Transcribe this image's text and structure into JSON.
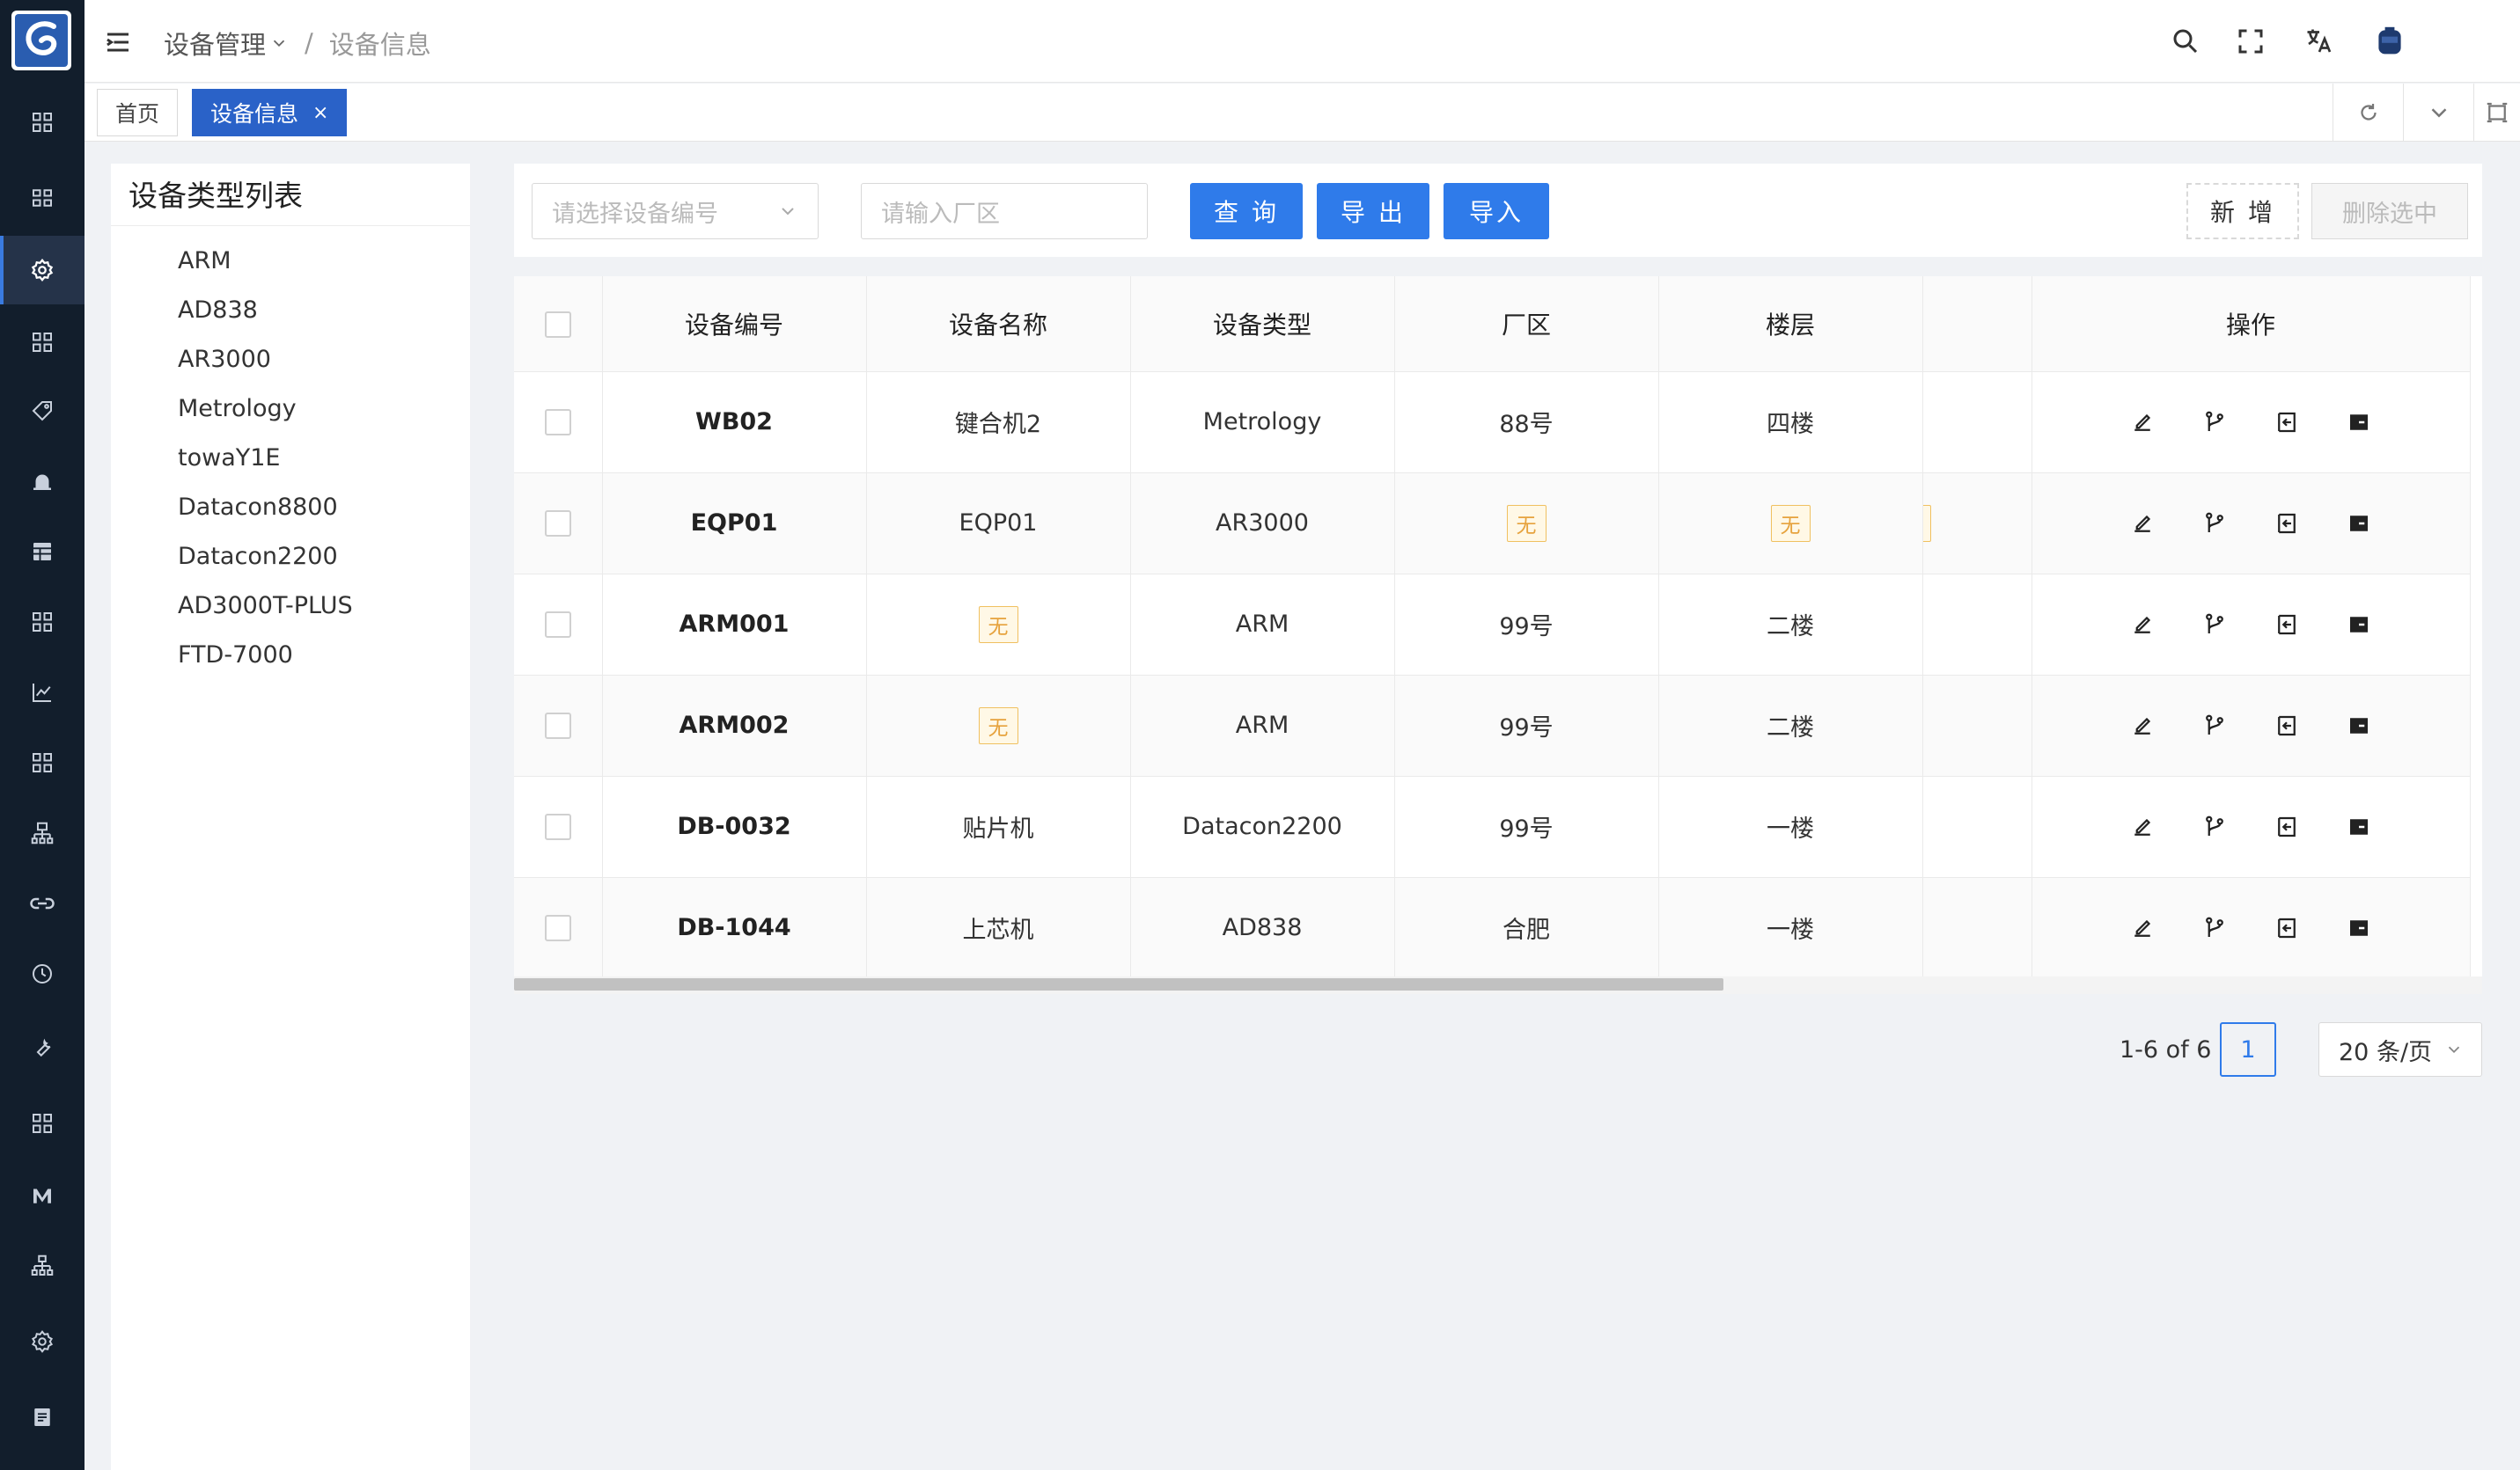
{
  "header": {
    "breadcrumb": [
      "设备管理",
      "设备信息"
    ],
    "separator": "/"
  },
  "tabs": [
    {
      "label": "首页",
      "closable": false,
      "active": false
    },
    {
      "label": "设备信息",
      "closable": true,
      "active": true,
      "close_label": "×"
    }
  ],
  "type_panel": {
    "title": "设备类型列表",
    "items": [
      "ARM",
      "AD838",
      "AR3000",
      "Metrology",
      "towaY1E",
      "Datacon8800",
      "Datacon2200",
      "AD3000T-PLUS",
      "FTD-7000"
    ]
  },
  "toolbar": {
    "device_select_placeholder": "请选择设备编号",
    "area_input_placeholder": "请输入厂区",
    "query_label": "查 询",
    "export_label": "导 出",
    "import_label": "导入",
    "add_label": "新 增",
    "delete_selected_label": "删除选中"
  },
  "table": {
    "columns": [
      "设备编号",
      "设备名称",
      "设备类型",
      "厂区",
      "楼层",
      "",
      "操作"
    ],
    "empty_tag": "无",
    "rows": [
      {
        "code": "WB02",
        "name": "键合机2",
        "type": "Metrology",
        "area": "88号",
        "floor": "四楼"
      },
      {
        "code": "EQP01",
        "name": "EQP01",
        "type": "AR3000",
        "area": "无",
        "floor": "无"
      },
      {
        "code": "ARM001",
        "name": "无",
        "type": "ARM",
        "area": "99号",
        "floor": "二楼"
      },
      {
        "code": "ARM002",
        "name": "无",
        "type": "ARM",
        "area": "99号",
        "floor": "二楼"
      },
      {
        "code": "DB-0032",
        "name": "贴片机",
        "type": "Datacon2200",
        "area": "99号",
        "floor": "一楼"
      },
      {
        "code": "DB-1044",
        "name": "上芯机",
        "type": "AD838",
        "area": "合肥",
        "floor": "一楼"
      }
    ],
    "row_actions": [
      "edit-icon",
      "branch-icon",
      "logout-icon",
      "card-icon"
    ]
  },
  "pagination": {
    "total_text": "1-6 of 6",
    "current_page": "1",
    "page_size": "20 条/页"
  },
  "colors": {
    "sidebar_bg": "#121e2c",
    "primary": "#2f7bea",
    "tab_active": "#2a62c8",
    "tag_warning": "#e6a23c"
  }
}
